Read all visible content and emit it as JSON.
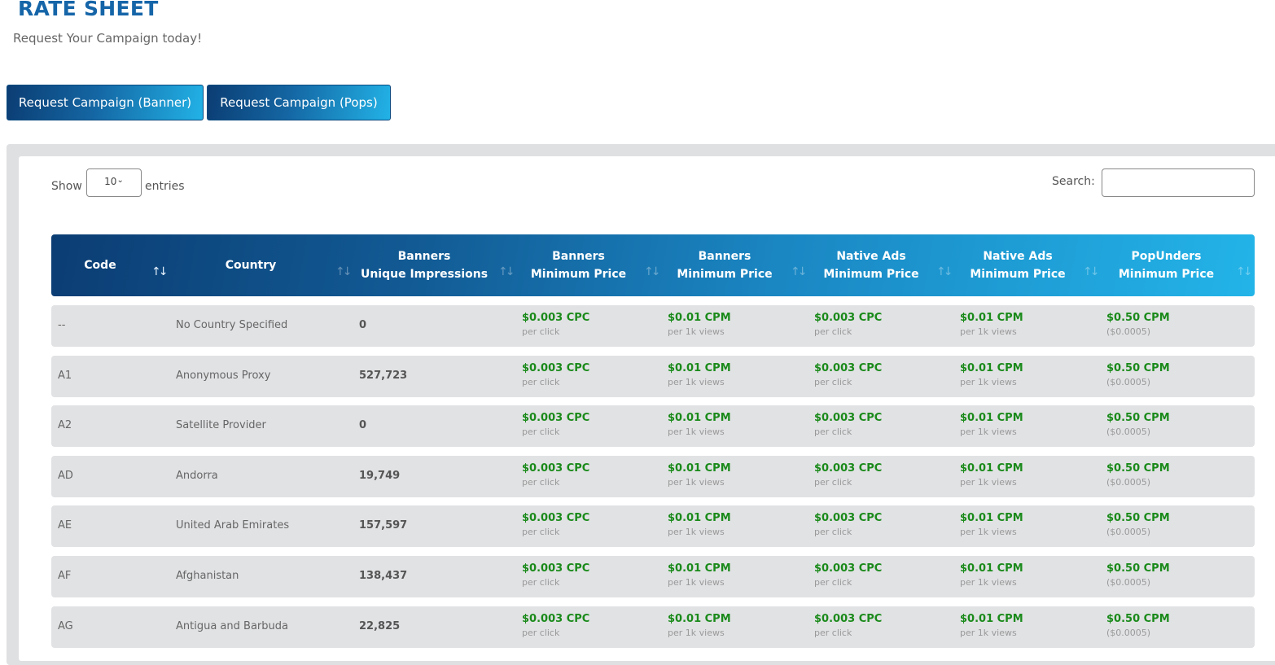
{
  "page": {
    "title": "RATE SHEET",
    "subtitle": "Request Your Campaign today!"
  },
  "buttons": {
    "banner": "Request Campaign (Banner)",
    "pops": "Request Campaign (Pops)"
  },
  "controls": {
    "show_label": "Show",
    "entries_value": "10",
    "entries_label": "entries",
    "search_label": "Search:",
    "search_value": ""
  },
  "icons": {
    "sort": "⇅",
    "chevron_down": "⌄"
  },
  "colors": {
    "accent_dark": "#0b3d73",
    "accent_light": "#23b4e8",
    "price_green": "#1a8a1a",
    "title_blue": "#1565a8"
  },
  "table": {
    "headers": [
      {
        "line1": "Code",
        "line2": ""
      },
      {
        "line1": "Country",
        "line2": ""
      },
      {
        "line1": "Banners",
        "line2": "Unique Impressions"
      },
      {
        "line1": "Banners",
        "line2": "Minimum Price"
      },
      {
        "line1": "Banners",
        "line2": "Minimum Price"
      },
      {
        "line1": "Native Ads",
        "line2": "Minimum Price"
      },
      {
        "line1": "Native Ads",
        "line2": "Minimum Price"
      },
      {
        "line1": "PopUnders",
        "line2": "Minimum Price"
      }
    ],
    "rows": [
      {
        "code": "--",
        "country": "No Country Specified",
        "impressions": "0",
        "prices": [
          {
            "main": "$0.003 CPC",
            "sub": "per click"
          },
          {
            "main": "$0.01 CPM",
            "sub": "per 1k views"
          },
          {
            "main": "$0.003 CPC",
            "sub": "per click"
          },
          {
            "main": "$0.01 CPM",
            "sub": "per 1k views"
          },
          {
            "main": "$0.50 CPM",
            "sub": "($0.0005)"
          }
        ]
      },
      {
        "code": "A1",
        "country": "Anonymous Proxy",
        "impressions": "527,723",
        "prices": [
          {
            "main": "$0.003 CPC",
            "sub": "per click"
          },
          {
            "main": "$0.01 CPM",
            "sub": "per 1k views"
          },
          {
            "main": "$0.003 CPC",
            "sub": "per click"
          },
          {
            "main": "$0.01 CPM",
            "sub": "per 1k views"
          },
          {
            "main": "$0.50 CPM",
            "sub": "($0.0005)"
          }
        ]
      },
      {
        "code": "A2",
        "country": "Satellite Provider",
        "impressions": "0",
        "prices": [
          {
            "main": "$0.003 CPC",
            "sub": "per click"
          },
          {
            "main": "$0.01 CPM",
            "sub": "per 1k views"
          },
          {
            "main": "$0.003 CPC",
            "sub": "per click"
          },
          {
            "main": "$0.01 CPM",
            "sub": "per 1k views"
          },
          {
            "main": "$0.50 CPM",
            "sub": "($0.0005)"
          }
        ]
      },
      {
        "code": "AD",
        "country": "Andorra",
        "impressions": "19,749",
        "prices": [
          {
            "main": "$0.003 CPC",
            "sub": "per click"
          },
          {
            "main": "$0.01 CPM",
            "sub": "per 1k views"
          },
          {
            "main": "$0.003 CPC",
            "sub": "per click"
          },
          {
            "main": "$0.01 CPM",
            "sub": "per 1k views"
          },
          {
            "main": "$0.50 CPM",
            "sub": "($0.0005)"
          }
        ]
      },
      {
        "code": "AE",
        "country": "United Arab Emirates",
        "impressions": "157,597",
        "prices": [
          {
            "main": "$0.003 CPC",
            "sub": "per click"
          },
          {
            "main": "$0.01 CPM",
            "sub": "per 1k views"
          },
          {
            "main": "$0.003 CPC",
            "sub": "per click"
          },
          {
            "main": "$0.01 CPM",
            "sub": "per 1k views"
          },
          {
            "main": "$0.50 CPM",
            "sub": "($0.0005)"
          }
        ]
      },
      {
        "code": "AF",
        "country": "Afghanistan",
        "impressions": "138,437",
        "prices": [
          {
            "main": "$0.003 CPC",
            "sub": "per click"
          },
          {
            "main": "$0.01 CPM",
            "sub": "per 1k views"
          },
          {
            "main": "$0.003 CPC",
            "sub": "per click"
          },
          {
            "main": "$0.01 CPM",
            "sub": "per 1k views"
          },
          {
            "main": "$0.50 CPM",
            "sub": "($0.0005)"
          }
        ]
      },
      {
        "code": "AG",
        "country": "Antigua and Barbuda",
        "impressions": "22,825",
        "prices": [
          {
            "main": "$0.003 CPC",
            "sub": "per click"
          },
          {
            "main": "$0.01 CPM",
            "sub": "per 1k views"
          },
          {
            "main": "$0.003 CPC",
            "sub": "per click"
          },
          {
            "main": "$0.01 CPM",
            "sub": "per 1k views"
          },
          {
            "main": "$0.50 CPM",
            "sub": "($0.0005)"
          }
        ]
      }
    ]
  }
}
